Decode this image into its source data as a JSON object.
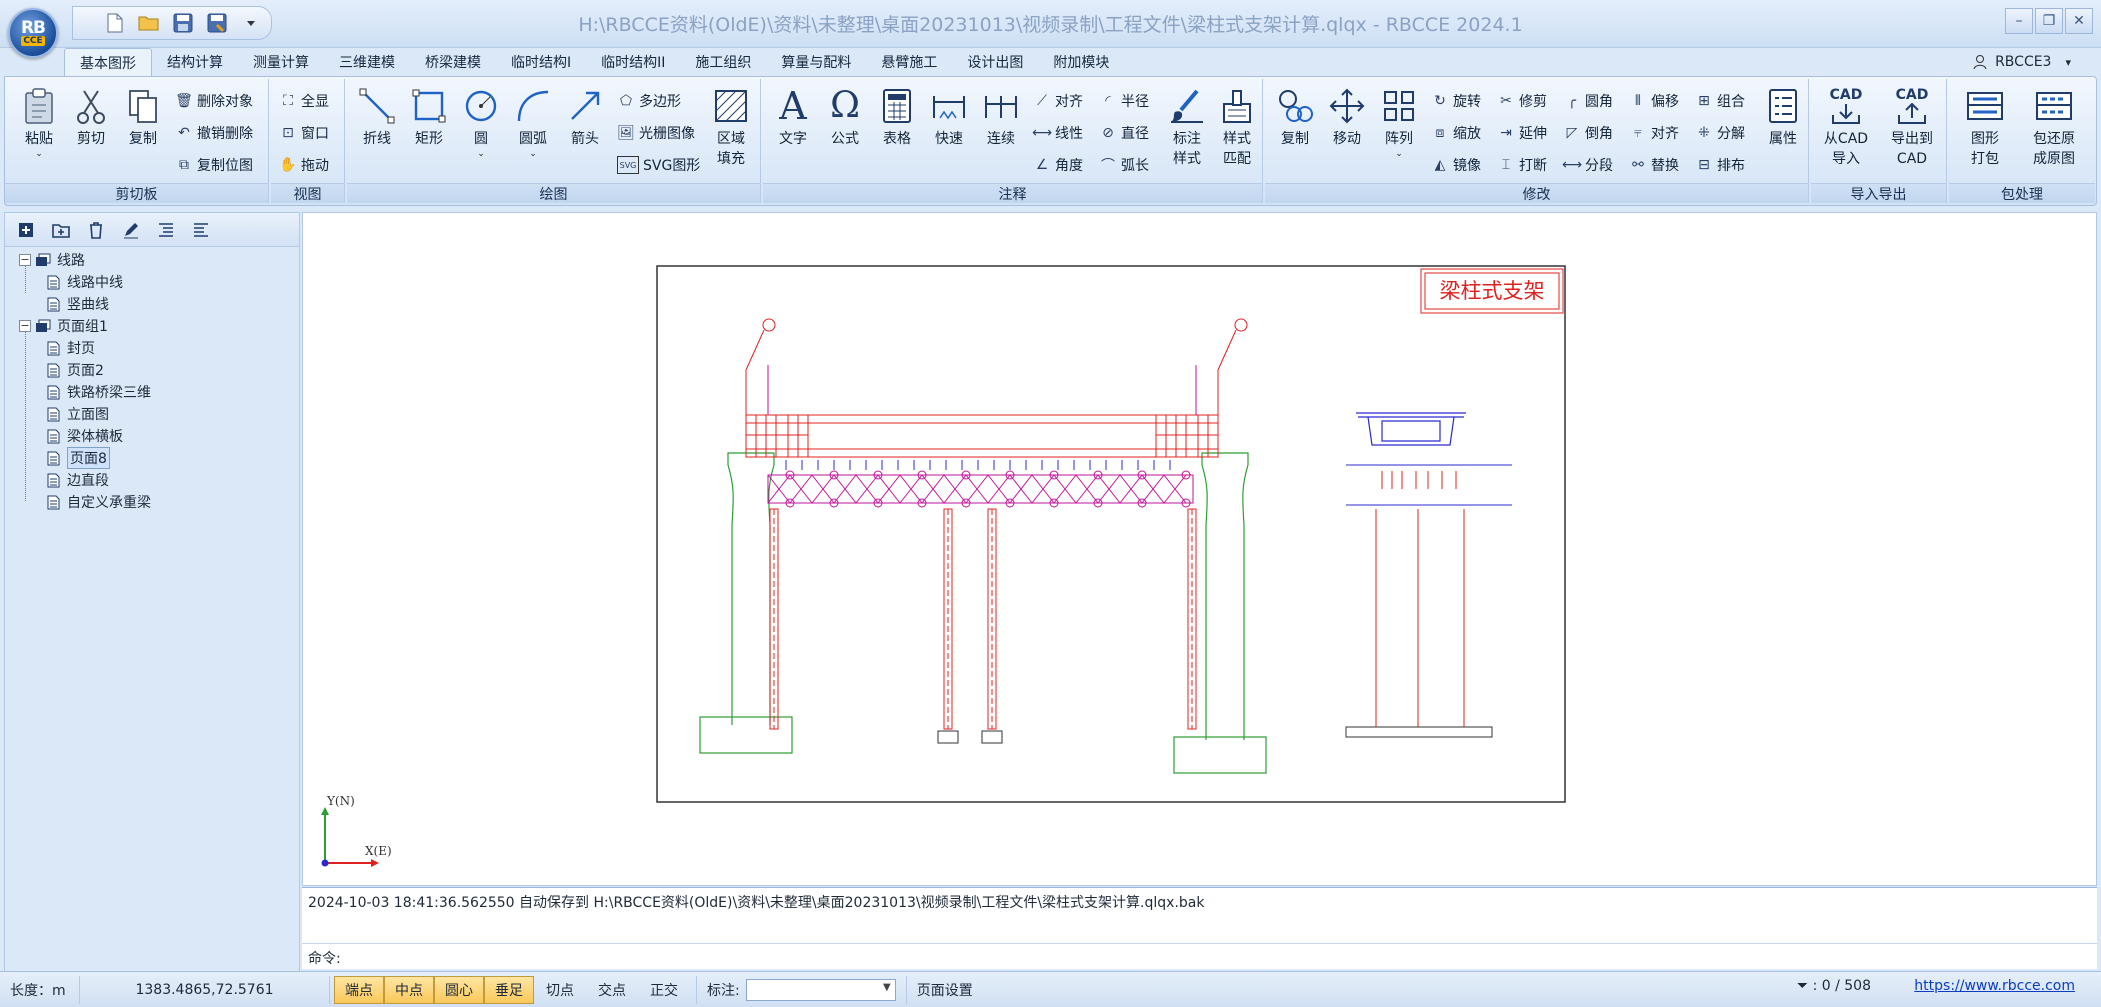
{
  "window": {
    "title": "H:\\RBCCE资料(OldE)\\资料\\未整理\\桌面20231013\\视频录制\\工程文件\\梁柱式支架计算.qlqx - RBCCE 2024.1",
    "logo_line1": "RB",
    "logo_line2": "CCE",
    "qat_icons": [
      "new-file-icon",
      "open-folder-icon",
      "save-icon",
      "save-as-icon",
      "customize-caret-icon"
    ],
    "controls": {
      "minimize": "–",
      "restore": "❐",
      "close": "✕"
    }
  },
  "tabs": [
    "基本图形",
    "结构计算",
    "测量计算",
    "三维建模",
    "桥梁建模",
    "临时结构I",
    "临时结构II",
    "施工组织",
    "算量与配料",
    "悬臂施工",
    "设计出图",
    "附加模块"
  ],
  "user": {
    "name": "RBCCE3"
  },
  "ribbon": {
    "clipboard": {
      "label": "剪切板",
      "paste": "粘贴",
      "cut": "剪切",
      "copy": "复制",
      "delete": "删除对象",
      "undo_delete": "撤销删除",
      "copy_pos": "复制位图"
    },
    "view": {
      "label": "视图",
      "fullview": "全显",
      "window": "窗口",
      "drag": "拖动"
    },
    "draw": {
      "label": "绘图",
      "polyline": "折线",
      "rect": "矩形",
      "circle": "圆",
      "arc": "圆弧",
      "arrow": "箭头",
      "polygon": "多边形",
      "raster": "光栅图像",
      "svg": "SVG图形",
      "hatch_line1": "区域",
      "hatch_line2": "填充"
    },
    "annotate": {
      "label": "注释",
      "text": "文字",
      "formula": "公式",
      "table": "表格",
      "quick": "快速",
      "continuous": "连续",
      "align": "对齐",
      "linear": "线性",
      "angle": "角度",
      "radius": "半径",
      "diameter": "直径",
      "arclen": "弧长",
      "markstyle_line1": "标注",
      "markstyle_line2": "样式",
      "stylematch_line1": "样式",
      "stylematch_line2": "匹配"
    },
    "modify": {
      "label": "修改",
      "copy": "复制",
      "move": "移动",
      "array": "阵列",
      "rotate": "旋转",
      "scale": "缩放",
      "mirror": "镜像",
      "trim": "修剪",
      "extend": "延伸",
      "break": "打断",
      "fillet": "圆角",
      "chamfer": "倒角",
      "divide": "分段",
      "offset": "偏移",
      "align": "对齐",
      "replace": "替换",
      "group": "组合",
      "explode": "分解",
      "arrange": "排布",
      "props": "属性"
    },
    "io": {
      "label": "导入导出",
      "from_cad_line1": "从CAD",
      "from_cad_line2": "导入",
      "to_cad_line1": "导出到",
      "to_cad_line2": "CAD",
      "cad_tag": "CAD"
    },
    "pack": {
      "label": "包处理",
      "pack_line1": "图形",
      "pack_line2": "打包",
      "restore_line1": "包还原",
      "restore_line2": "成原图"
    }
  },
  "tree": {
    "items": [
      {
        "label": "线路",
        "level": 0,
        "expander": "−"
      },
      {
        "label": "线路中线",
        "level": 1
      },
      {
        "label": "竖曲线",
        "level": 1
      },
      {
        "label": "页面组1",
        "level": 0,
        "expander": "−"
      },
      {
        "label": "封页",
        "level": 1
      },
      {
        "label": "页面2",
        "level": 1
      },
      {
        "label": "铁路桥梁三维",
        "level": 1
      },
      {
        "label": "立面图",
        "level": 1
      },
      {
        "label": "梁体横板",
        "level": 1
      },
      {
        "label": "页面8",
        "level": 1,
        "selected": true
      },
      {
        "label": "边直段",
        "level": 1
      },
      {
        "label": "自定义承重梁",
        "level": 1
      }
    ]
  },
  "drawing": {
    "title": "梁柱式支架",
    "axis_y": "Y(N)",
    "axis_x": "X(E)",
    "colors": {
      "red": "#e0201f",
      "green": "#2d9e33",
      "magenta": "#c1129a",
      "blue": "#2a2ad0",
      "frame": "#333333"
    }
  },
  "log": {
    "text": "2024-10-03 18:41:36.562550 自动保存到 H:\\RBCCE资料(OldE)\\资料\\未整理\\桌面20231013\\视频录制\\工程文件\\梁柱式支架计算.qlqx.bak"
  },
  "cmd": {
    "label": "命令:"
  },
  "status": {
    "length_label": "长度：m",
    "coords": "1383.4865,72.5761",
    "snaps_on": [
      "端点",
      "中点",
      "圆心",
      "垂足"
    ],
    "snaps_off": [
      "切点",
      "交点",
      "正交"
    ],
    "mark_label": "标注:",
    "page_setup": "页面设置",
    "count": ": 0 / 508",
    "link": "https://www.rbcce.com"
  }
}
